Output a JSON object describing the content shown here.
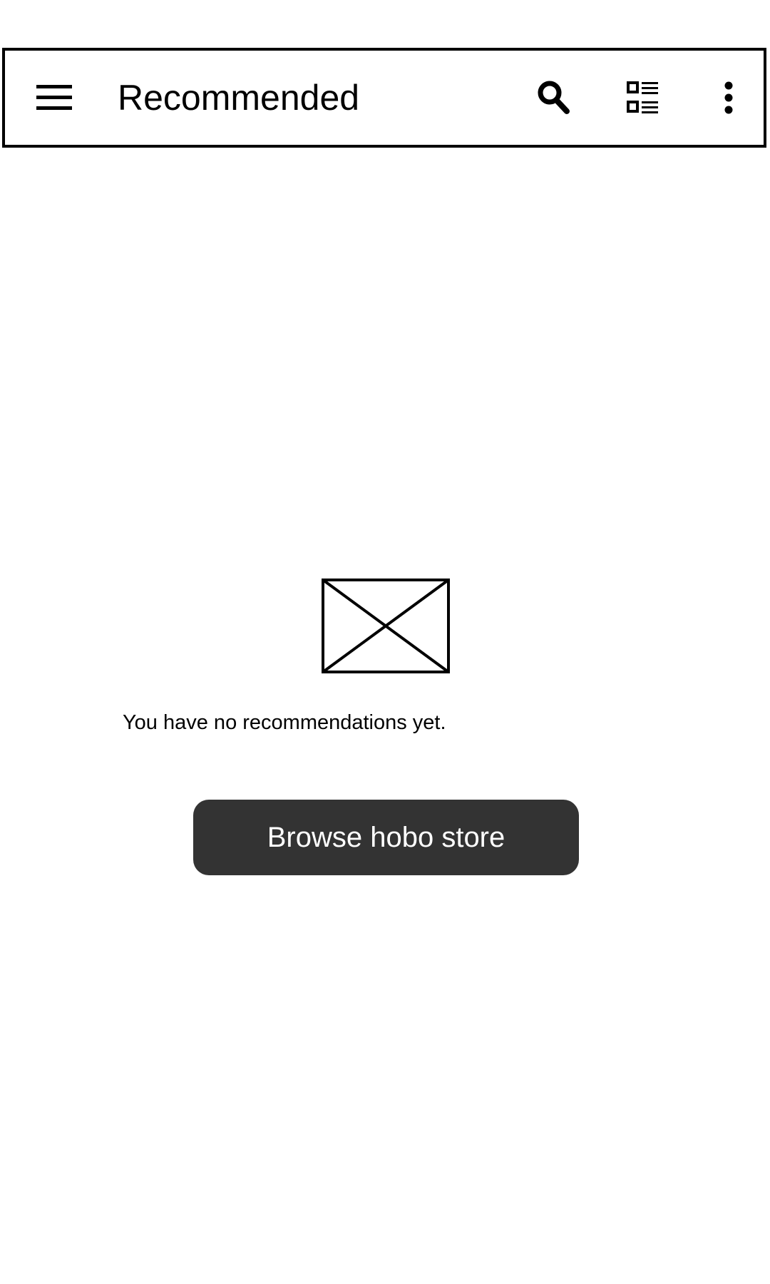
{
  "appbar": {
    "title": "Recommended",
    "icons": {
      "menu": "hamburger-menu-icon",
      "search": "search-icon",
      "layout": "list-layout-icon",
      "more": "more-vertical-icon"
    }
  },
  "empty_state": {
    "image": "image-placeholder",
    "message": "You have no recommendations yet.",
    "button_label": "Browse hobo store"
  },
  "colors": {
    "background": "#ffffff",
    "foreground": "#000000",
    "button_bg": "#333333",
    "button_text": "#ffffff"
  }
}
